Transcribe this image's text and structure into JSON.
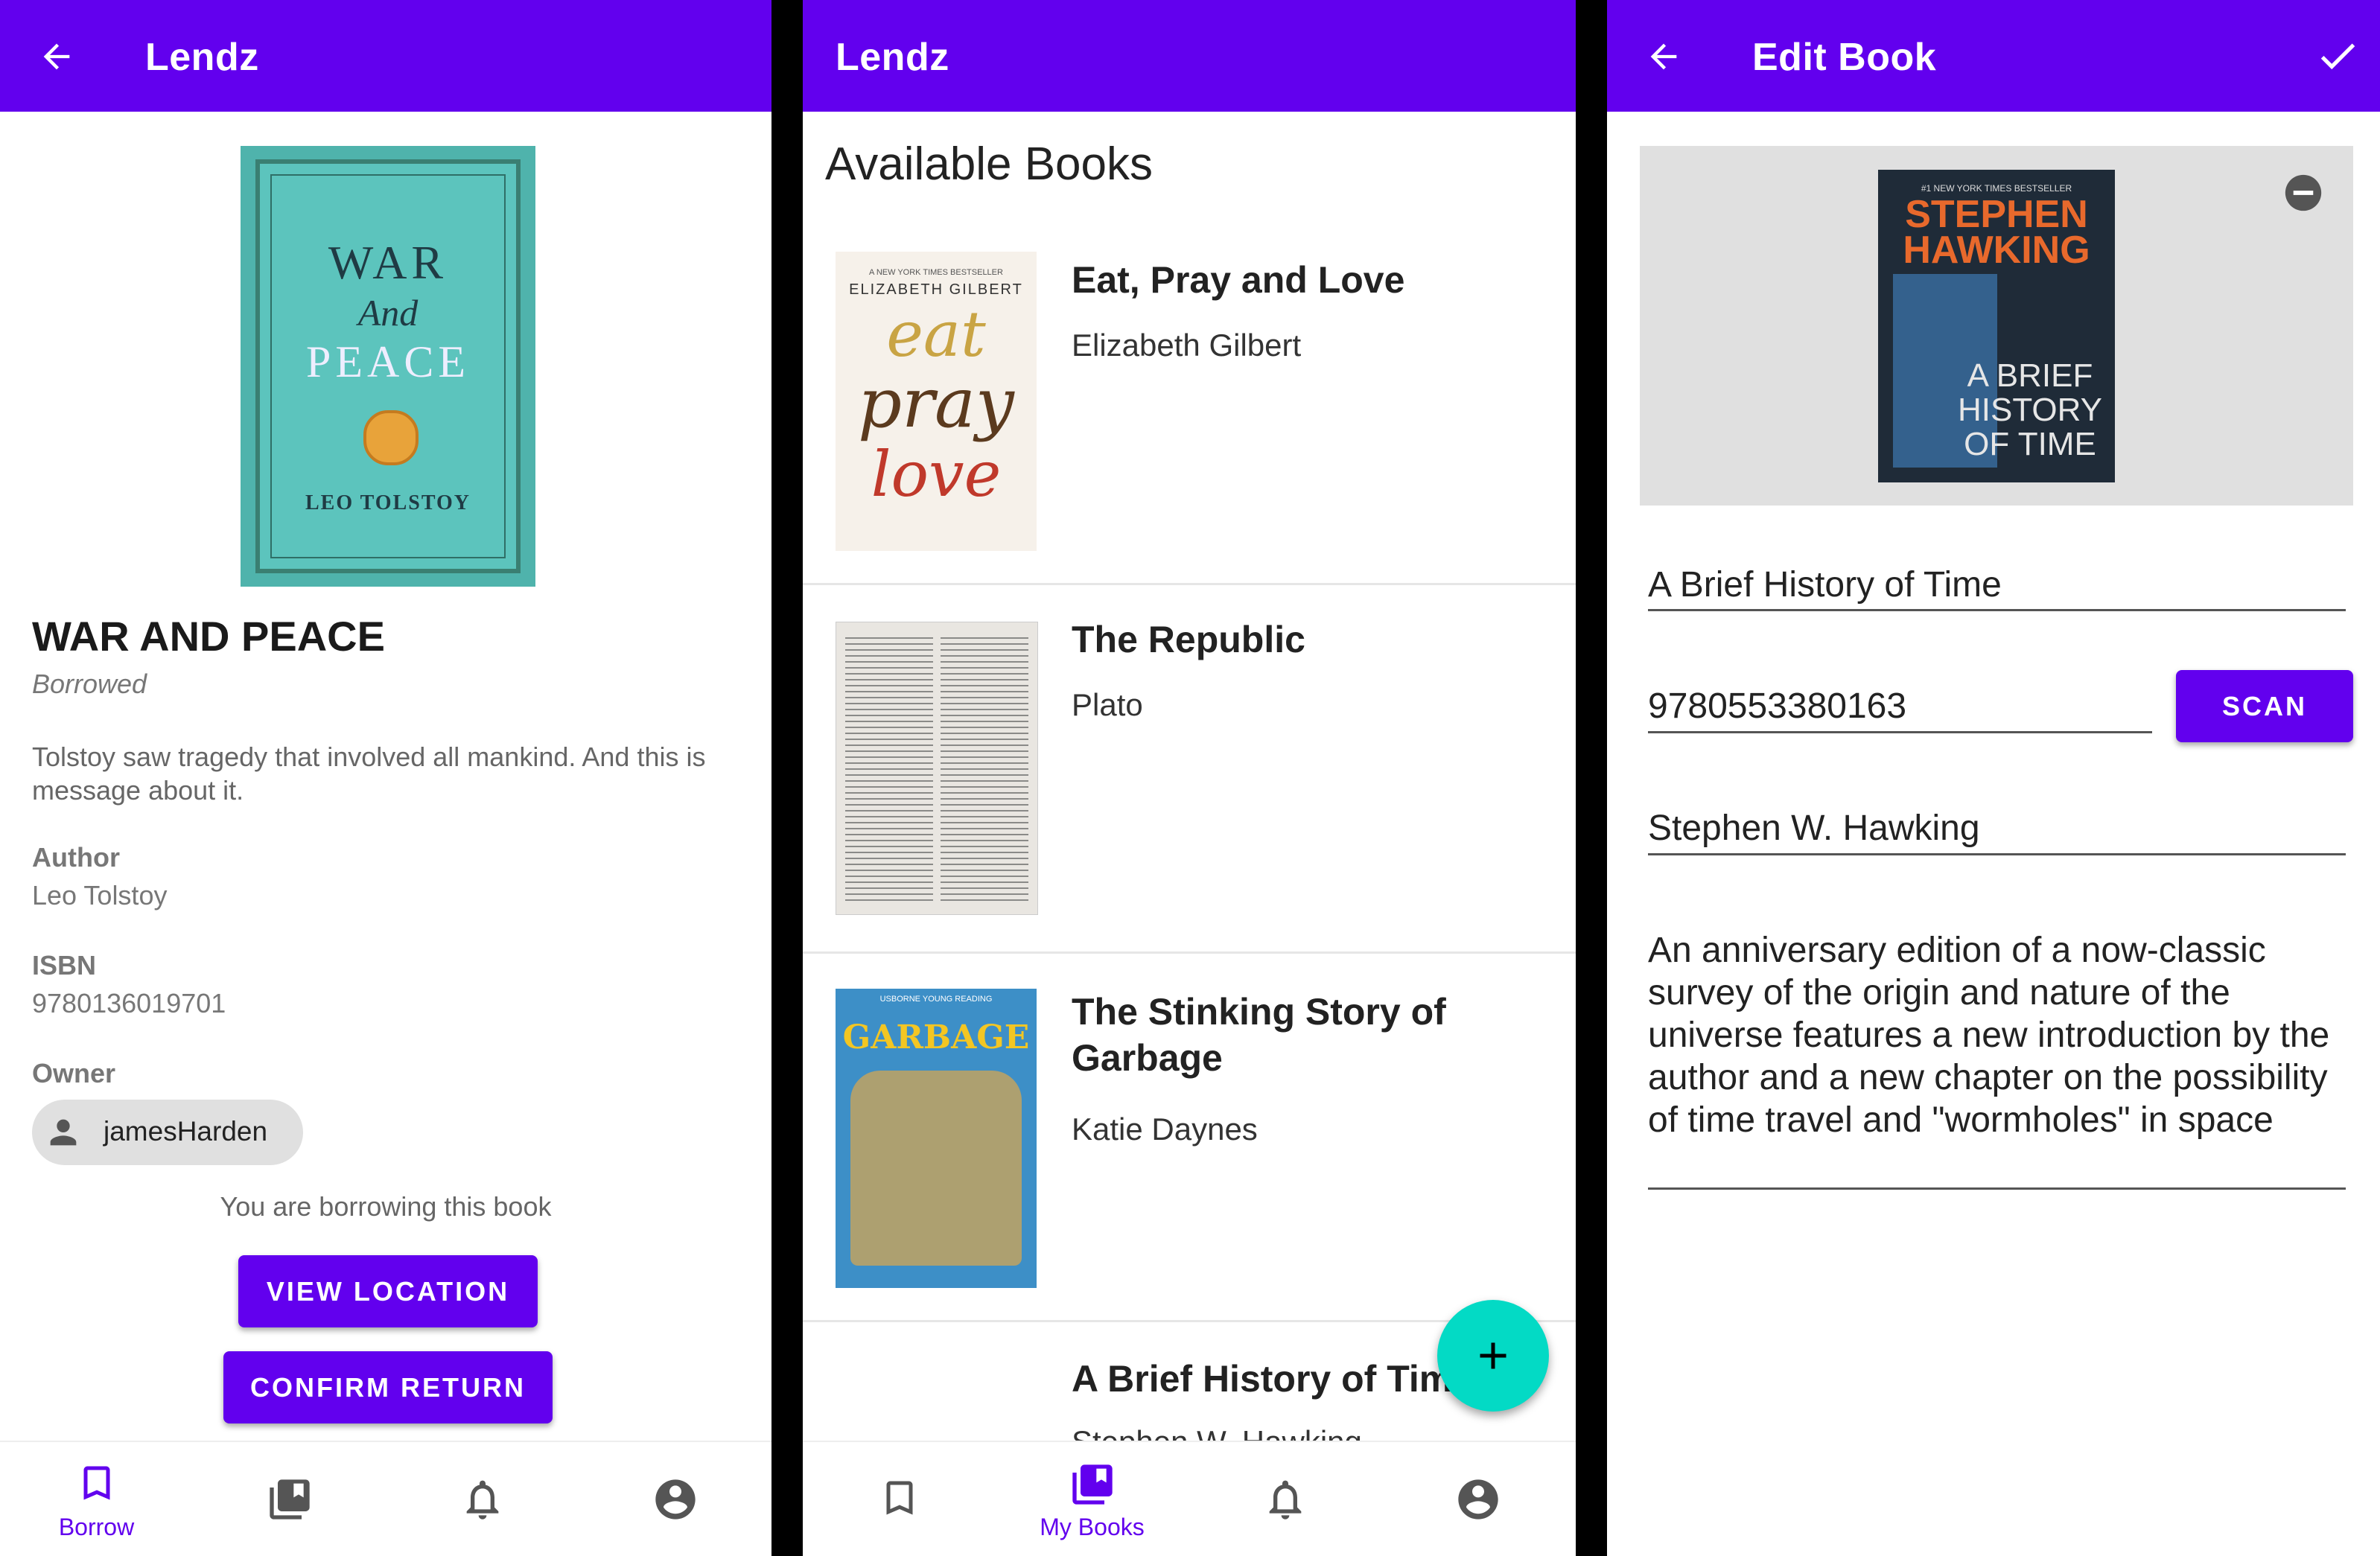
{
  "colors": {
    "primary": "#6200ee",
    "fab": "#03dac5",
    "chip": "#e0e0e0"
  },
  "detail": {
    "app_title": "Lendz",
    "cover": {
      "line1": "WAR",
      "line2": "And",
      "line3": "PEACE",
      "line4": "LEO TOLSTOY"
    },
    "book_title": "WAR AND PEACE",
    "status": "Borrowed",
    "description": "Tolstoy saw tragedy that involved all mankind. And this is message about it.",
    "author_label": "Author",
    "author_value": "Leo Tolstoy",
    "isbn_label": "ISBN",
    "isbn_value": "9780136019701",
    "owner_label": "Owner",
    "owner_value": "jamesHarden",
    "borrowing_note": "You are borrowing this book",
    "view_location_label": "VIEW LOCATION",
    "confirm_return_label": "CONFIRM RETURN",
    "nav": {
      "borrow_label": "Borrow"
    }
  },
  "list": {
    "app_title": "Lendz",
    "heading": "Available Books",
    "books": [
      {
        "title": "Eat, Pray and Love",
        "author": "Elizabeth Gilbert"
      },
      {
        "title": "The Republic",
        "author": "Plato"
      },
      {
        "title": "The Stinking Story of Garbage",
        "author": "Katie Daynes"
      },
      {
        "title": "A Brief History of Time",
        "author": "Stephen W. Hawking"
      }
    ],
    "covers": {
      "eat_top": "A NEW YORK TIMES BESTSELLER",
      "eat_author": "ELIZABETH GILBERT",
      "eat_w1": "eat",
      "eat_w2": "pray",
      "eat_w3": "love",
      "garbage_top": "USBORNE YOUNG READING",
      "garbage_title": "GARBAGE"
    },
    "nav": {
      "mybooks_label": "My Books"
    }
  },
  "edit": {
    "app_title": "Edit Book",
    "cover": {
      "top": "#1 NEW YORK TIMES BESTSELLER",
      "name1": "STEPHEN",
      "name2": "HAWKING",
      "t1": "A BRIEF",
      "t2": "HISTORY",
      "t3": "OF TIME"
    },
    "title_value": "A Brief History of Time",
    "isbn_value": "9780553380163",
    "scan_label": "SCAN",
    "author_value": "Stephen W. Hawking",
    "description_value": "An anniversary edition of a now-classic survey of the origin and nature of the universe features a new introduction by the author and a new chapter on the possibility of time travel and \"wormholes\" in space"
  }
}
